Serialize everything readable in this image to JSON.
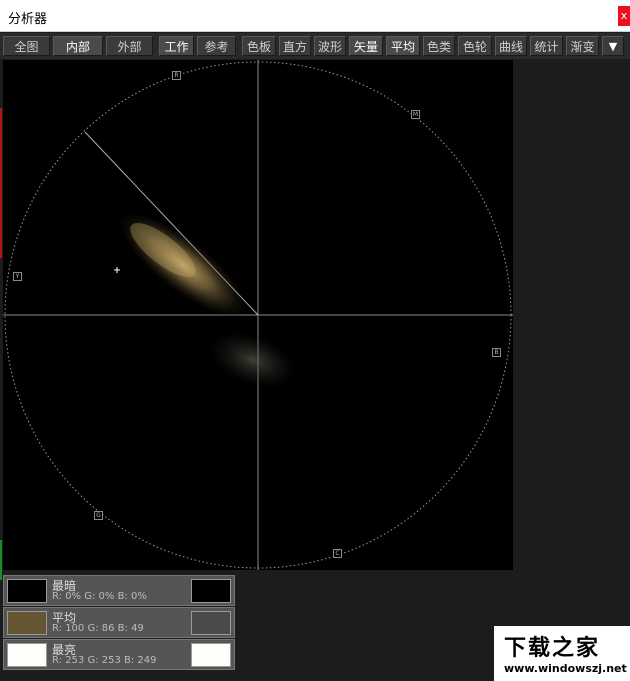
{
  "window": {
    "title": "分析器",
    "close_glyph": "x"
  },
  "toolbar": {
    "tabs": [
      {
        "label": "全图"
      },
      {
        "label": "内部"
      },
      {
        "label": "外部"
      },
      {
        "label": "工作"
      },
      {
        "label": "参考"
      },
      {
        "label": "色板"
      },
      {
        "label": "直方"
      },
      {
        "label": "波形"
      },
      {
        "label": "矢量"
      },
      {
        "label": "平均"
      },
      {
        "label": "色类"
      },
      {
        "label": "色轮"
      },
      {
        "label": "曲线"
      },
      {
        "label": "统计"
      },
      {
        "label": "渐变"
      }
    ],
    "dropdown_glyph": "▼"
  },
  "scope": {
    "markers": {
      "r": "R",
      "m": "M",
      "y": "Y",
      "b": "B",
      "g": "G",
      "c": "C"
    }
  },
  "stats": {
    "darkest": {
      "name": "最暗",
      "values": "R: 0%  G: 0%  B: 0%",
      "color": "#000000"
    },
    "average": {
      "name": "平均",
      "values": "R: 100  G: 86  B: 49",
      "color": "#645631"
    },
    "brightest": {
      "name": "最亮",
      "values": "R: 253  G: 253  B: 249",
      "color": "#fdfdf9"
    }
  },
  "watermark": {
    "logo": "下载之家",
    "url": "www.windowszj.net"
  }
}
